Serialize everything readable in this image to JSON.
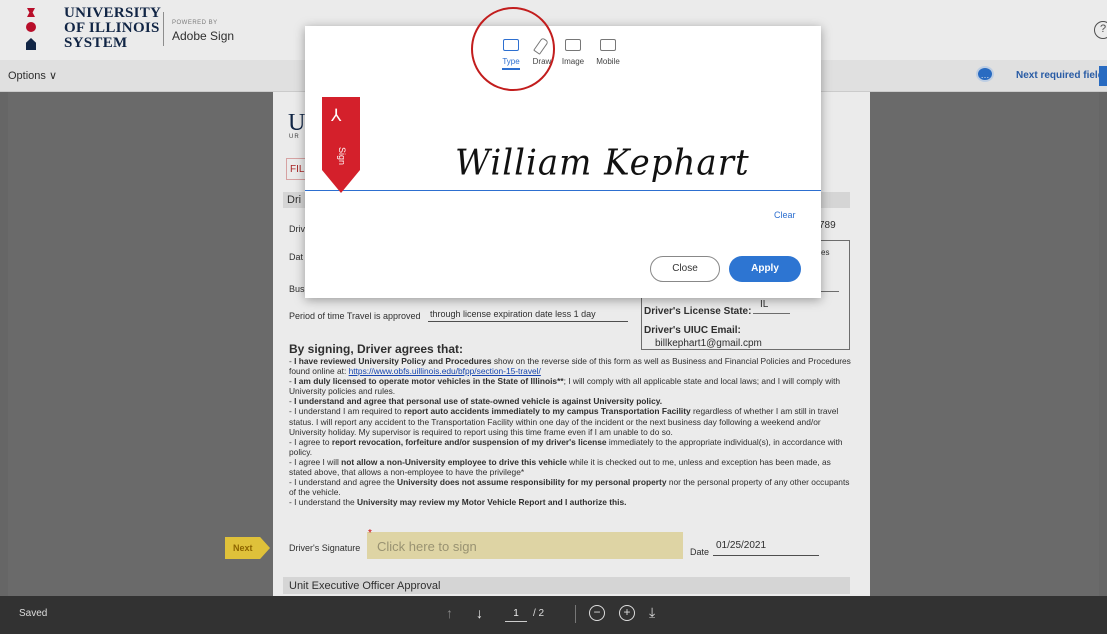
{
  "header": {
    "org_line1": "UNIVERSITY",
    "org_line2": "OF ILLINOIS",
    "org_line3": "SYSTEM",
    "powered_by": "POWERED BY",
    "product": "Adobe Sign",
    "help": "?"
  },
  "toolbar": {
    "options": "Options ∨",
    "comment_icon": "chat-bubble-icon",
    "next_required": "Next required field"
  },
  "document": {
    "letter": "U",
    "sub": "UR",
    "fil_tag": "FIL",
    "section_driver": "Dri",
    "driver_row1": "Driv",
    "driver_row2": "Dat",
    "driver_row3": "Bus",
    "num_frag": "789",
    "ses_frag": "ses",
    "license_state_label": "Driver's License State:",
    "license_state_value": "IL",
    "email_label": "Driver's UIUC Email:",
    "email_value": "billkephart1@gmail.cpm",
    "period_label": "Period of time Travel is approved",
    "period_value": "through license expiration date less 1 day",
    "agree_title": "By signing, Driver agrees that:",
    "t1a": "- ",
    "t1b": "I have reviewed University Policy and Procedures",
    "t1c": " show on the reverse side of this form as well as Business and Financial Policies and Procedures found online at: ",
    "t1link": "https://www.obfs.uillinois.edu/bfpp/section-15-travel/",
    "t2b": "I am duly licensed to operate motor vehicles in the State of Illinois**",
    "t2c": "; I will comply with all applicable state and local laws; and I will comply with University policies and rules.",
    "t3b": "I understand and agree that personal use of state-owned vehicle is against University policy.",
    "t4a": "I understand I am required to ",
    "t4b": "report auto accidents immediately to my campus Transportation Facility",
    "t4c": " regardless of whether I am still in travel status.  I will report any accident to the Transportation Facility within one day of the incident or the next business day following a weekend and/or University holiday.  My supervisor is required to report using this time frame even if I am unable to do so.",
    "t5a": "I agree to ",
    "t5b": "report revocation, forfeiture and/or suspension of my driver's license",
    "t5c": " immediately to the appropriate individual(s), in accordance with policy.",
    "t6a": "I agree I will ",
    "t6b": "not allow a non-University employee to drive this vehicle",
    "t6c": " while it is checked out to me, unless and exception has been made, as stated above, that allows a non-employee to have the privilege*",
    "t7a": "I understand and agree the ",
    "t7b": "University does not assume responsibility for my personal property",
    "t7c": " nor the personal property of any other occupants of the vehicle.",
    "t8a": "I understand the ",
    "t8b": "University may review my Motor Vehicle Report and I authorize this.",
    "sig_label": "Driver's Signature",
    "sig_required": "*",
    "sig_placeholder": "Click here to sign",
    "date_label": "Date",
    "date_value": "01/25/2021",
    "unit_exec": "Unit Executive Officer Approval",
    "next_tag": "Next"
  },
  "modal": {
    "tabs": [
      {
        "label": "Type",
        "icon": "keyboard-icon",
        "active": true
      },
      {
        "label": "Draw",
        "icon": "pen-icon",
        "active": false
      },
      {
        "label": "Image",
        "icon": "image-icon",
        "active": false
      },
      {
        "label": "Mobile",
        "icon": "mobile-icon",
        "active": false
      }
    ],
    "typed_signature": "William Kephart",
    "ribbon_text": "Sign",
    "clear": "Clear",
    "close": "Close",
    "apply": "Apply"
  },
  "footer": {
    "status": "Saved",
    "page_current": "1",
    "page_total": "/ 2"
  },
  "colors": {
    "accent": "#2d75d2",
    "ribbon": "#d4202b",
    "highlight_circle": "#c21d1d",
    "next_tag": "#f2d23f"
  }
}
